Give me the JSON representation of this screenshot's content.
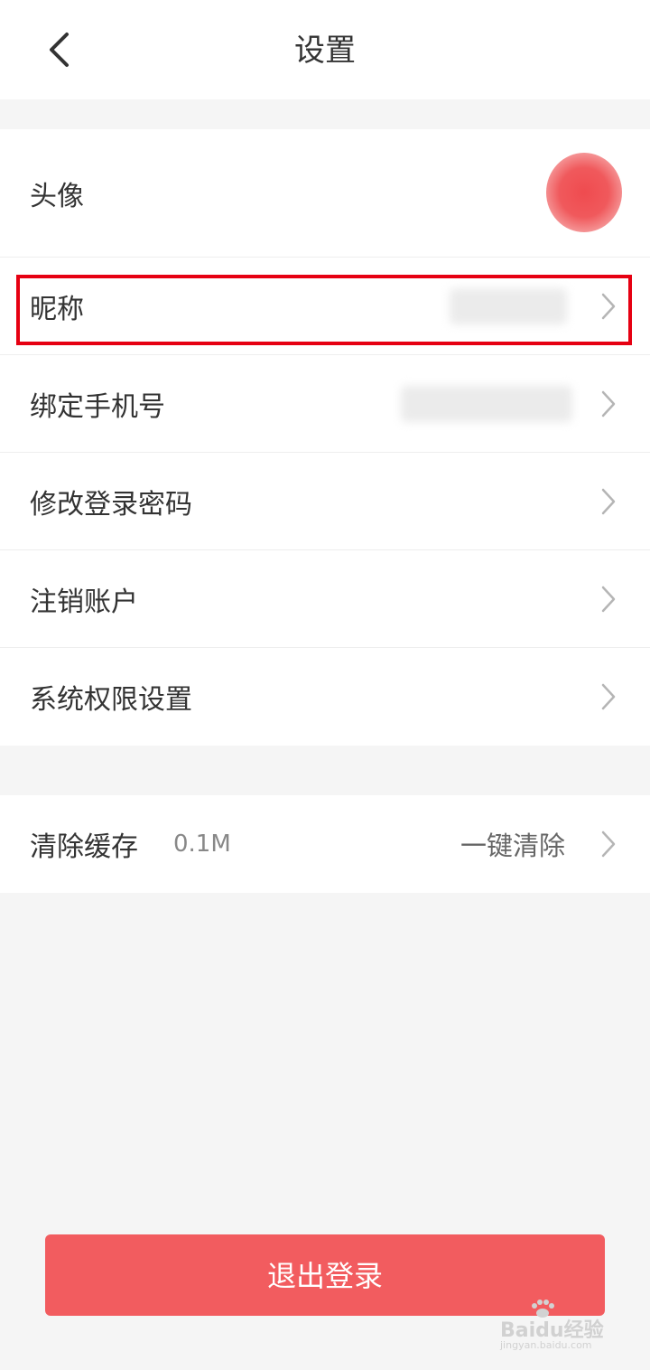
{
  "header": {
    "title": "设置"
  },
  "profile": {
    "avatar_label": "头像",
    "nickname_label": "昵称",
    "phone_label": "绑定手机号",
    "password_label": "修改登录密码",
    "close_account_label": "注销账户",
    "permissions_label": "系统权限设置"
  },
  "cache": {
    "label": "清除缓存",
    "size": "0.1M",
    "action": "一键清除"
  },
  "logout": {
    "label": "退出登录"
  },
  "watermark": {
    "brand": "Baidu经验",
    "url": "jingyan.baidu.com"
  },
  "colors": {
    "logout_button": "#f25c5f",
    "highlight_border": "#e60012",
    "avatar": "#ef4b4f"
  }
}
